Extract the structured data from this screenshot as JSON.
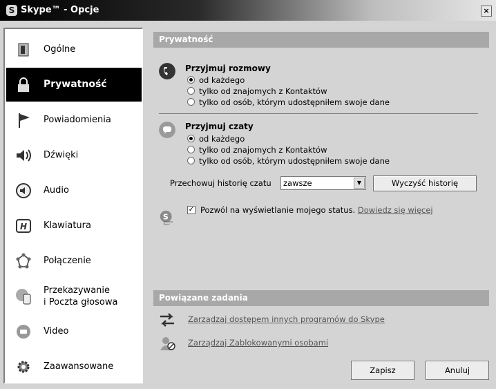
{
  "window": {
    "title": "Skype™ - Opcje",
    "app_icon_glyph": "S",
    "close_glyph": "×"
  },
  "sidebar": {
    "items": [
      {
        "label": "Ogólne",
        "icon": "general-icon",
        "active": false
      },
      {
        "label": "Prywatność",
        "icon": "lock-icon",
        "active": true
      },
      {
        "label": "Powiadomienia",
        "icon": "flag-icon",
        "active": false
      },
      {
        "label": "Dźwięki",
        "icon": "speaker-icon",
        "active": false
      },
      {
        "label": "Audio",
        "icon": "audio-icon",
        "active": false
      },
      {
        "label": "Klawiatura",
        "icon": "keyboard-icon",
        "active": false
      },
      {
        "label": "Połączenie",
        "icon": "connection-icon",
        "active": false
      },
      {
        "label": "Przekazywanie\ni Poczta głosowa",
        "icon": "forwarding-icon",
        "active": false
      },
      {
        "label": "Video",
        "icon": "video-icon",
        "active": false
      },
      {
        "label": "Zaawansowane",
        "icon": "gear-icon",
        "active": false
      }
    ]
  },
  "privacy": {
    "header": "Prywatność",
    "calls": {
      "title": "Przyjmuj rozmowy",
      "icon": "phone-icon",
      "options": [
        "od każdego",
        "tylko od znajomych z Kontaktów",
        "tylko od osób, którym udostępniłem swoje dane"
      ],
      "selected": 0
    },
    "chats": {
      "title": "Przyjmuj czaty",
      "icon": "chat-icon",
      "options": [
        "od każdego",
        "tylko od znajomych z Kontaktów",
        "tylko od osób, którym udostępniłem swoje dane"
      ],
      "selected": 0
    },
    "history": {
      "label": "Przechowuj historię czatu",
      "value": "zawsze",
      "clear_button": "Wyczyść historię"
    },
    "status": {
      "checked": true,
      "check_glyph": "✓",
      "text": "Pozwól na wyświetlanie mojego status.",
      "link": "Dowiedz się więcej"
    }
  },
  "related": {
    "header": "Powiązane zadania",
    "tasks": [
      {
        "label": "Zarządzaj dostępem innych programów do Skype",
        "icon": "arrows-icon"
      },
      {
        "label": "Zarządzaj Zablokowanymi osobami",
        "icon": "blocked-user-icon"
      }
    ]
  },
  "buttons": {
    "save": "Zapisz",
    "cancel": "Anuluj"
  },
  "colors": {
    "active_nav": "#000000",
    "section_header": "#a8a8a8",
    "link": "#555555"
  }
}
